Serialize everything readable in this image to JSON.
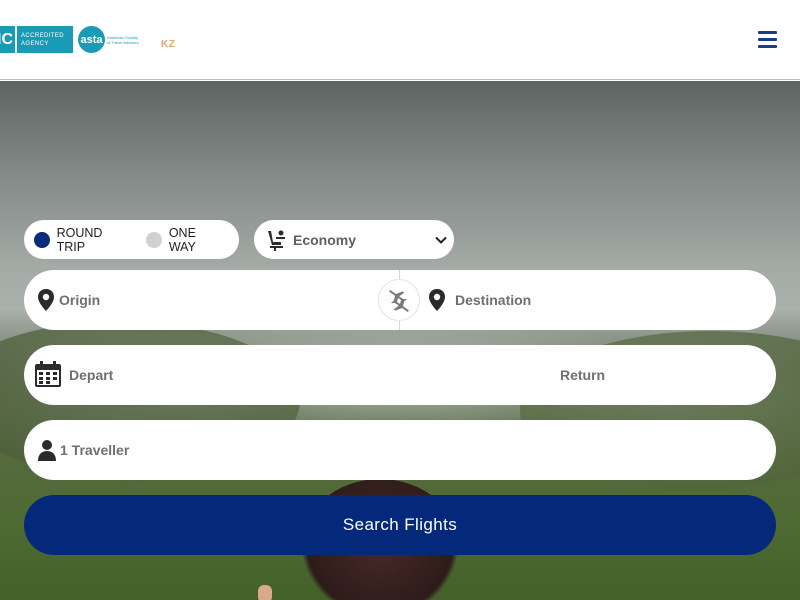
{
  "header": {
    "logo_iatc_mark": "IATC",
    "logo_iatc_text": "Accredited Agency",
    "logo_asta_text": "asta",
    "logo_asta_subtext": "American Society of Travel Advisors",
    "country_code": "KZ",
    "menu_icon": "hamburger-icon"
  },
  "search": {
    "trip_types": [
      {
        "label": "ROUND TRIP",
        "selected": true
      },
      {
        "label": "ONE WAY",
        "selected": false
      }
    ],
    "cabin_class": "Economy",
    "origin_placeholder": "Origin",
    "destination_placeholder": "Destination",
    "depart_placeholder": "Depart",
    "return_placeholder": "Return",
    "travellers": "1 Traveller",
    "submit_label": "Search Flights"
  },
  "colors": {
    "accent": "#05297a",
    "brand_teal": "#1a9bb5",
    "country_code": "#e8a765",
    "menu_icon": "#1e3a8a"
  }
}
